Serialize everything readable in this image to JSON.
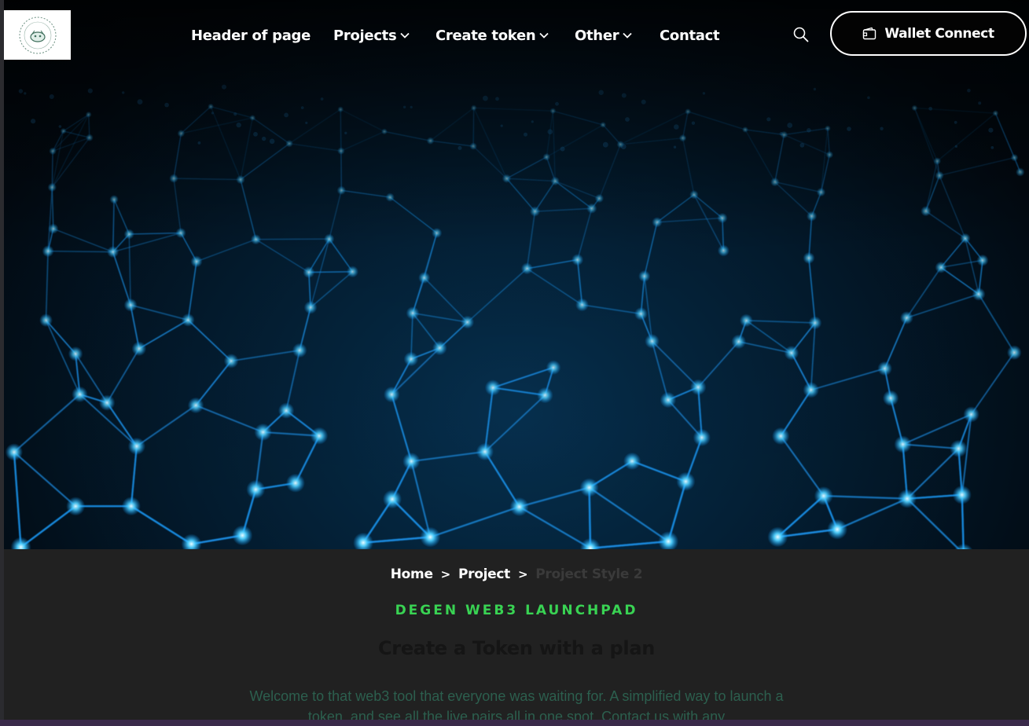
{
  "header": {
    "logo_alt": "logo",
    "nav": [
      {
        "label": "Header of page",
        "has_dropdown": false
      },
      {
        "label": "Projects",
        "has_dropdown": true
      },
      {
        "label": "Create token",
        "has_dropdown": true
      },
      {
        "label": "Other",
        "has_dropdown": true
      },
      {
        "label": "Contact",
        "has_dropdown": false
      }
    ],
    "search_icon": "search-icon",
    "wallet_button": {
      "label": "Wallet Connect",
      "icon": "wallet-icon"
    }
  },
  "hero": {
    "image": "blue network nodes background"
  },
  "breadcrumb": {
    "home": "Home",
    "project": "Project",
    "separator": ">",
    "current": "Project Style 2"
  },
  "section": {
    "eyebrow": "DEGEN WEB3 LAUNCHPAD",
    "title": "Create a Token with a plan",
    "description": "Welcome to that web3 tool that everyone was waiting for. A simplified way to launch a token, and see all the live pairs all in one spot. Contact us with any"
  },
  "colors": {
    "accent_green": "#39d353",
    "network_blue": "#0a9cff",
    "background": "#212121",
    "description_text": "#2c5f4e"
  }
}
